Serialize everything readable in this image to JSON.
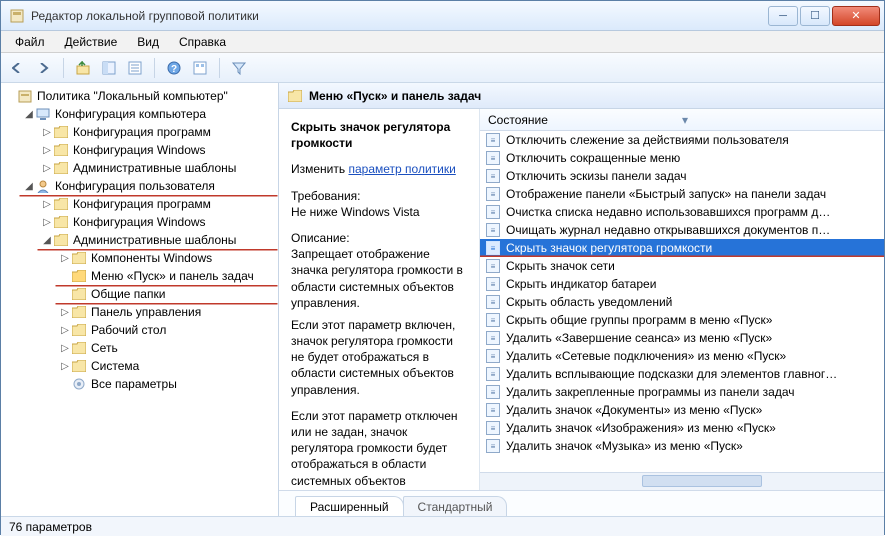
{
  "window": {
    "title": "Редактор локальной групповой политики"
  },
  "menubar": {
    "file": "Файл",
    "action": "Действие",
    "view": "Вид",
    "help": "Справка"
  },
  "tree": {
    "root": "Политика \"Локальный компьютер\"",
    "comp_cfg": "Конфигурация компьютера",
    "cc_programs": "Конфигурация программ",
    "cc_windows": "Конфигурация Windows",
    "cc_admintpl": "Административные шаблоны",
    "user_cfg": "Конфигурация пользователя",
    "uc_programs": "Конфигурация программ",
    "uc_windows": "Конфигурация Windows",
    "uc_admintpl": "Административные шаблоны",
    "at_components": "Компоненты Windows",
    "at_startmenu": "Меню «Пуск» и панель задач",
    "at_shared": "Общие папки",
    "at_ctrlpanel": "Панель управления",
    "at_desktop": "Рабочий стол",
    "at_network": "Сеть",
    "at_system": "Система",
    "at_allparams": "Все параметры"
  },
  "right": {
    "header": "Меню «Пуск» и панель задач",
    "col_state": "Состояние"
  },
  "detail": {
    "title": "Скрыть значок регулятора громкости",
    "edit_label": "Изменить",
    "edit_link": "параметр политики",
    "req_label": "Требования:",
    "req_value": "Не ниже Windows Vista",
    "desc_label": "Описание:",
    "desc_p1": " Запрещает отображение значка регулятора громкости в области системных объектов управления.",
    "desc_p2": "Если этот параметр включен, значок регулятора громкости не будет отображаться в области системных объектов управления.",
    "desc_p3": "Если этот параметр отключен или не задан, значок регулятора громкости будет отображаться в области системных объектов управления."
  },
  "policies": [
    "Отключить слежение за действиями пользователя",
    "Отключить сокращенные меню",
    "Отключить эскизы панели задач",
    "Отображение панели «Быстрый запуск» на панели задач",
    "Очистка списка недавно использовавшихся программ д…",
    "Очищать журнал недавно открывавшихся документов п…",
    "Скрыть значок регулятора громкости",
    "Скрыть значок сети",
    "Скрыть индикатор батареи",
    "Скрыть область уведомлений",
    "Скрыть общие группы программ в меню «Пуск»",
    "Удалить «Завершение сеанса» из меню «Пуск»",
    "Удалить «Сетевые подключения» из меню «Пуск»",
    "Удалить всплывающие подсказки для элементов главног…",
    "Удалить закрепленные программы из панели задач",
    "Удалить значок «Документы» из меню «Пуск»",
    "Удалить значок «Изображения» из меню «Пуск»",
    "Удалить значок «Музыка» из меню «Пуск»"
  ],
  "tabs": {
    "extended": "Расширенный",
    "standard": "Стандартный"
  },
  "status": {
    "text": "76 параметров"
  },
  "selected_policy_index": 6
}
